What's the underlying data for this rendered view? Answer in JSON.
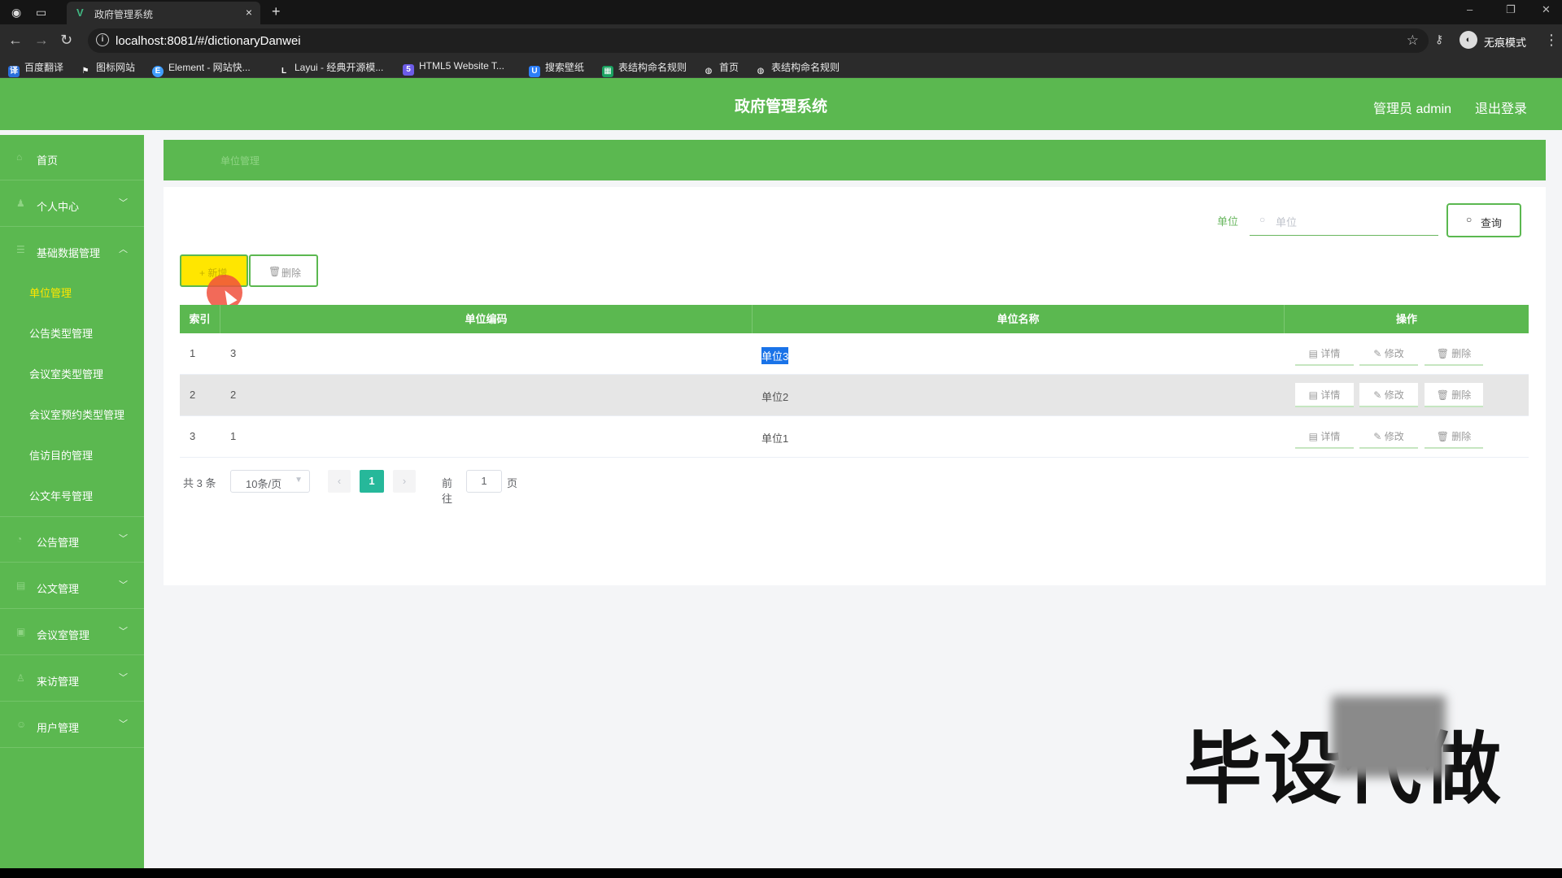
{
  "browser": {
    "tab_title": "政府管理系统",
    "url": "localhost:8081/#/dictionaryDanwei",
    "profile_label": "无痕模式",
    "bookmarks": [
      {
        "label": "百度翻译",
        "color": "#2a6fdb",
        "icon": "translate-icon"
      },
      {
        "label": "图标网站",
        "color": "#333333",
        "icon": "flag-icon"
      },
      {
        "label": "Element - 网站快...",
        "color": "#409eff",
        "icon": "element-icon"
      },
      {
        "label": "Layui - 经典开源模...",
        "color": "#555555",
        "icon": "layui-icon"
      },
      {
        "label": "HTML5 Website T...",
        "color": "#6c5ce7",
        "icon": "html5-icon"
      },
      {
        "label": "搜索壁纸",
        "color": "#2d7ff9",
        "icon": "wallpaper-icon"
      },
      {
        "label": "表结构命名规则",
        "color": "#1aa260",
        "icon": "sheet-icon"
      },
      {
        "label": "首页",
        "color": "#666666",
        "icon": "globe-icon"
      },
      {
        "label": "表结构命名规则",
        "color": "#666666",
        "icon": "globe-icon"
      }
    ]
  },
  "header": {
    "title": "政府管理系统",
    "admin_label": "管理员 admin",
    "logout_label": "退出登录"
  },
  "sidebar": {
    "items": [
      {
        "label": "首页",
        "has_arrow": false
      },
      {
        "label": "个人中心",
        "has_arrow": true,
        "arrow": "﹀"
      },
      {
        "label": "基础数据管理",
        "has_arrow": true,
        "arrow": "︿"
      }
    ],
    "sub_items": [
      {
        "label": "单位管理",
        "active": true
      },
      {
        "label": "公告类型管理",
        "active": false
      },
      {
        "label": "会议室类型管理",
        "active": false
      },
      {
        "label": "会议室预约类型管理",
        "active": false
      },
      {
        "label": "信访目的管理",
        "active": false
      },
      {
        "label": "公文年号管理",
        "active": false
      }
    ],
    "groups": [
      {
        "label": "公告管理",
        "arrow": "﹀"
      },
      {
        "label": "公文管理",
        "arrow": "﹀"
      },
      {
        "label": "会议室管理",
        "arrow": "﹀"
      },
      {
        "label": "来访管理",
        "arrow": "﹀"
      },
      {
        "label": "用户管理",
        "arrow": "﹀"
      }
    ]
  },
  "breadcrumb": "单位管理",
  "search": {
    "label": "单位",
    "placeholder": "单位",
    "query_label": "查询"
  },
  "toolbar": {
    "add_label": "+ 新增",
    "delete_label": "删除"
  },
  "table": {
    "headers": [
      "索引",
      "单位编码",
      "单位名称",
      "操作"
    ],
    "rows": [
      {
        "index": "1",
        "code": "3",
        "name": "单位3",
        "selected": true
      },
      {
        "index": "2",
        "code": "2",
        "name": "单位2",
        "selected": false
      },
      {
        "index": "3",
        "code": "1",
        "name": "单位1",
        "selected": false
      }
    ],
    "actions": {
      "detail": "详情",
      "edit": "修改",
      "delete": "删除"
    }
  },
  "pagination": {
    "total_text": "共 3 条",
    "page_size": "10条/页",
    "current_page": "1",
    "goto_label": "前往",
    "goto_value": "1",
    "page_suffix": "页"
  },
  "watermark": "毕设代做",
  "colors": {
    "primary_green": "#5bb850",
    "accent_yellow": "#ffe600",
    "pager_active": "#26b89a"
  }
}
